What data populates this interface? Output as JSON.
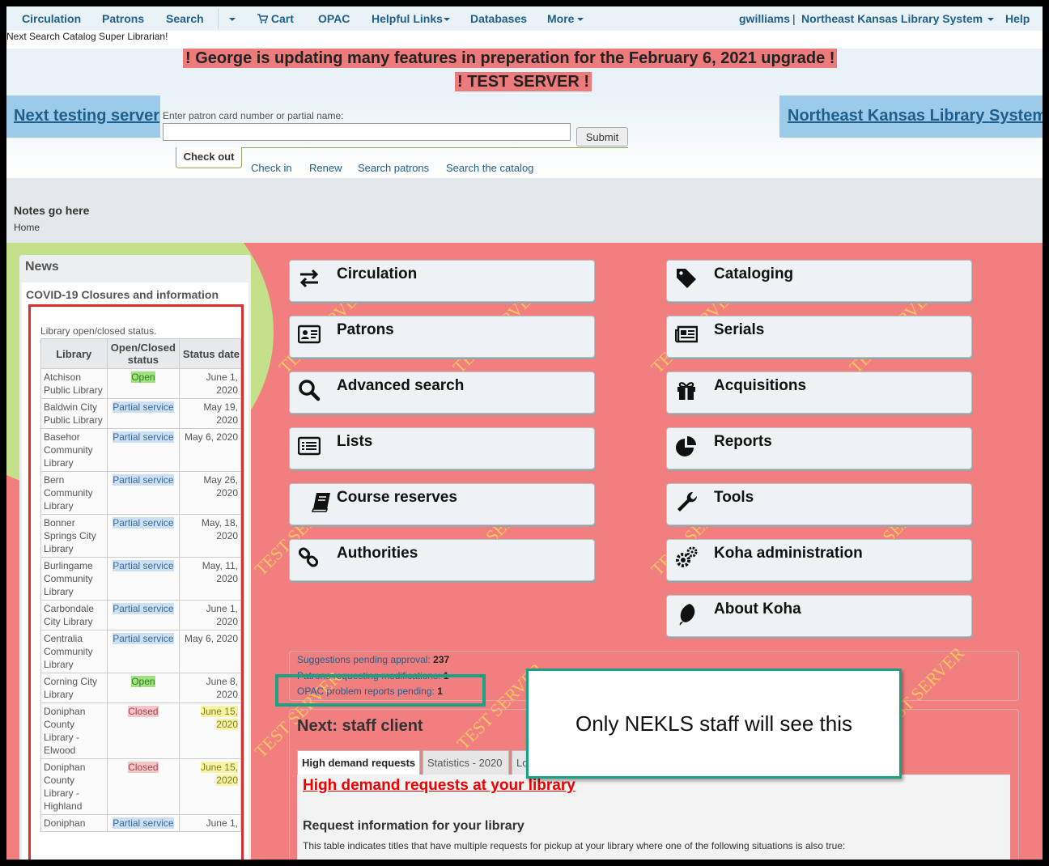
{
  "nav": {
    "left": [
      "Circulation",
      "Patrons",
      "Search",
      "Cart",
      "OPAC",
      "Helpful Links",
      "Databases",
      "More"
    ],
    "user": "gwilliams",
    "separator": "|",
    "library": "Northeast Kansas Library System",
    "help": "Help"
  },
  "subtitle": "Next Search Catalog Super Librarian!",
  "banners": {
    "line1": "! George is updating many features in preperation for the February 6, 2021 upgrade !",
    "line2": "! TEST SERVER !"
  },
  "header": {
    "left_link": "Next testing server",
    "right_link": "Northeast Kansas Library System",
    "patron_label": "Enter patron card number or partial name:",
    "patron_value": "",
    "submit": "Submit",
    "tabs": [
      "Check out",
      "Check in",
      "Renew",
      "Search patrons",
      "Search the catalog"
    ]
  },
  "notes": {
    "title": "Notes go here",
    "breadcrumb": "Home"
  },
  "news": {
    "title": "News",
    "item_title": "COVID-19 Closures and information",
    "intro": "Library open/closed status.",
    "columns": [
      "Library",
      "Open/Closed status",
      "Status date"
    ],
    "rows": [
      {
        "library": "Atchison Public Library",
        "status": "Open",
        "date": "June 1, 2020"
      },
      {
        "library": "Baldwin City Public Library",
        "status": "Partial service",
        "date": "May 19, 2020"
      },
      {
        "library": "Basehor Community Library",
        "status": "Partial service",
        "date": "May 6, 2020"
      },
      {
        "library": "Bern Community Library",
        "status": "Partial service",
        "date": "May 26, 2020"
      },
      {
        "library": "Bonner Springs City Library",
        "status": "Partial service",
        "date": "May, 18, 2020"
      },
      {
        "library": "Burlingame Community Library",
        "status": "Partial service",
        "date": "May, 11, 2020"
      },
      {
        "library": "Carbondale City Library",
        "status": "Partial service",
        "date": "June 1, 2020"
      },
      {
        "library": "Centralia Community Library",
        "status": "Partial service",
        "date": "May 6, 2020"
      },
      {
        "library": "Corning City Library",
        "status": "Open",
        "date": "June 8, 2020"
      },
      {
        "library": "Doniphan County Library - Elwood",
        "status": "Closed",
        "date": "June 15, 2020"
      },
      {
        "library": "Doniphan County Library - Highland",
        "status": "Closed",
        "date": "June 15, 2020"
      },
      {
        "library": "Doniphan",
        "status": "Partial service",
        "date": "June 1,"
      }
    ]
  },
  "modules": {
    "left": [
      "Circulation",
      "Patrons",
      "Advanced search",
      "Lists",
      "Course reserves",
      "Authorities"
    ],
    "right": [
      "Cataloging",
      "Serials",
      "Acquisitions",
      "Reports",
      "Tools",
      "Koha administration",
      "About Koha"
    ],
    "icons_left": [
      "arrows-exchange-icon",
      "id-card-icon",
      "search-icon",
      "list-icon",
      "book-icon",
      "link-icon"
    ],
    "icons_right": [
      "tag-icon",
      "newspaper-icon",
      "gift-icon",
      "pie-chart-icon",
      "wrench-icon",
      "gears-icon",
      "koha-leaf-icon"
    ]
  },
  "pending": {
    "suggestions_label": "Suggestions pending approval:",
    "suggestions_count": "237",
    "patrons_label": "Patrons requesting modifications:",
    "patrons_count": "1",
    "opac_label": "OPAC problem reports pending:",
    "opac_count": "1"
  },
  "next_section": {
    "title": "Next: staff client",
    "tabs": [
      "High demand requests",
      "Statistics - 2020",
      "Lo"
    ],
    "high_demand_link": "High demand requests at your library",
    "request_title": "Request information for your library",
    "request_desc": "This table indicates titles that have multiple requests for pickup at your library where one of the following situations is also true:"
  },
  "watermark": "TEST SERVER",
  "callout": "Only NEKLS staff will see this",
  "colors": {
    "main_bg": "#f27f7f",
    "blob": "#c5e08b",
    "banner_bg": "#ee7b7b",
    "link": "#1f5f8b",
    "callout_border": "#1aa082",
    "news_border": "#d9302f"
  }
}
